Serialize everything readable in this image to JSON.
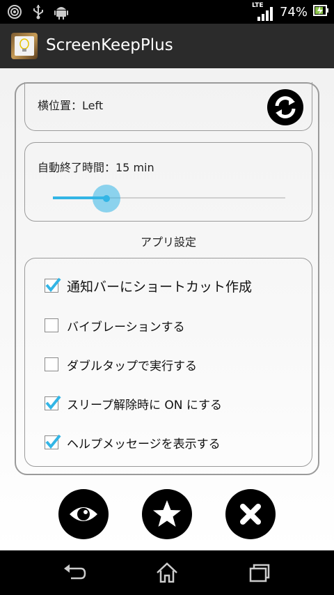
{
  "status_bar": {
    "icons": [
      "target-icon",
      "usb-icon",
      "android-icon"
    ],
    "network": "LTE",
    "battery_percent": "74%"
  },
  "action_bar": {
    "app_title": "ScreenKeepPlus"
  },
  "position_card": {
    "label": "横位置：Left"
  },
  "timer_card": {
    "label": "自動終了時間：15 min",
    "slider_value_fraction": 0.23
  },
  "app_settings": {
    "title": "アプリ設定",
    "options": [
      {
        "label": "通知バーにショートカット作成",
        "checked": true
      },
      {
        "label": "バイブレーションする",
        "checked": false
      },
      {
        "label": "ダブルタップで実行する",
        "checked": false
      },
      {
        "label": "スリープ解除時に ON にする",
        "checked": true
      },
      {
        "label": "ヘルプメッセージを表示する",
        "checked": true
      }
    ]
  },
  "bottom_buttons": [
    "eye-icon",
    "star-icon",
    "close-icon"
  ],
  "colors": {
    "accent": "#33b5e5",
    "checkmark": "#33b5e5",
    "action_bar": "#2b2b2b"
  }
}
